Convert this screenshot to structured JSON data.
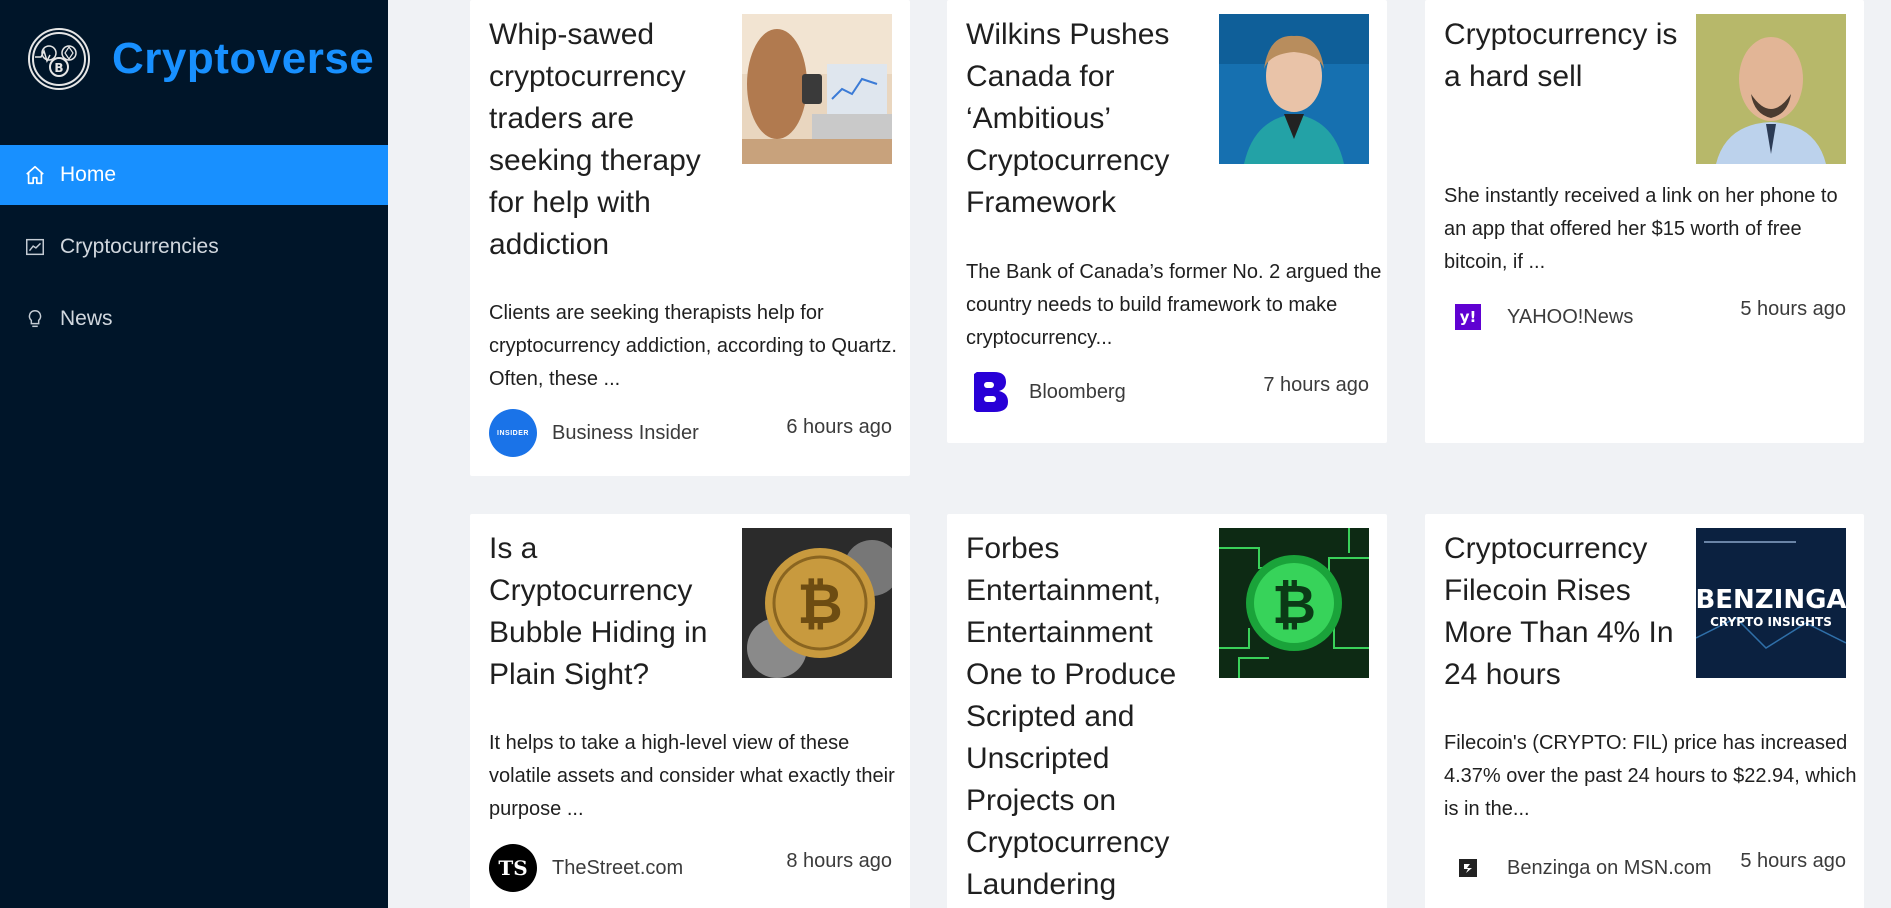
{
  "app": {
    "title": "Cryptoverse"
  },
  "menu": {
    "items": [
      {
        "label": "Home",
        "icon": "home-icon",
        "active": true
      },
      {
        "label": "Cryptocurrencies",
        "icon": "chart-icon",
        "active": false
      },
      {
        "label": "News",
        "icon": "bulb-icon",
        "active": false
      }
    ]
  },
  "news": [
    {
      "title": "Whip-sawed cryptocurrency traders are seeking therapy for help with addiction",
      "description": "Clients are seeking therapists help for cryptocurrency addiction, according to Quartz. Often, these ...",
      "provider": "Business Insider",
      "provider_logo_text": "INSIDER",
      "time": "6 hours ago"
    },
    {
      "title": "Wilkins Pushes Canada for ‘Ambitious’ Cryptocurrency Framework",
      "description": "The Bank of Canada’s former No. 2 argued the country needs to build framework to make cryptocurrency...",
      "provider": "Bloomberg",
      "provider_logo_text": "B",
      "time": "7 hours ago"
    },
    {
      "title": "Cryptocurrency is a hard sell",
      "description": "She instantly received a link on her phone to an app that offered her $15 worth of free bitcoin, if ...",
      "provider": "YAHOO!News",
      "provider_logo_text": "y!",
      "time": "5 hours ago"
    },
    {
      "title": "Is a Cryptocurrency Bubble Hiding in Plain Sight?",
      "description": "It helps to take a high-level view of these volatile assets and consider what exactly their purpose ...",
      "provider": "TheStreet.com",
      "provider_logo_text": "TS",
      "time": "8 hours ago"
    },
    {
      "title": "Forbes Entertainment, Entertainment One to Produce Scripted and Unscripted Projects on Cryptocurrency Laundering",
      "description": "",
      "provider": "",
      "provider_logo_text": "",
      "time": ""
    },
    {
      "title": "Cryptocurrency Filecoin Rises More Than 4% In 24 hours",
      "description": "Filecoin's (CRYPTO: FIL) price has increased 4.37% over the past 24 hours to $22.94, which is in the...",
      "provider": "Benzinga on MSN.com",
      "provider_logo_text": "",
      "time": "5 hours ago",
      "thumb_text_1": "BENZINGA",
      "thumb_text_2": "CRYPTO INSIGHTS"
    }
  ],
  "colors": {
    "sidebar_bg": "#001529",
    "accent": "#1890ff",
    "page_bg": "#f0f2f5"
  }
}
